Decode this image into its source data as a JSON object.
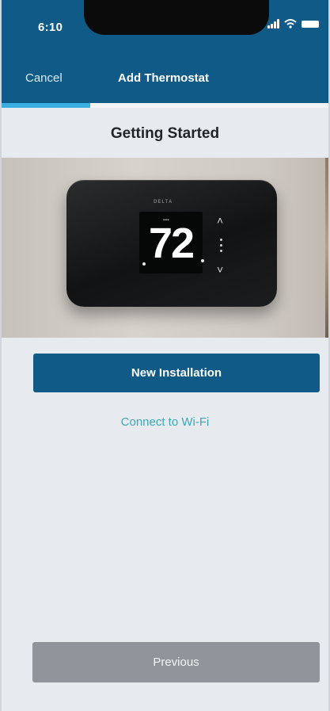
{
  "status_bar": {
    "time": "6:10",
    "signal_icon": "cellular-signal-icon",
    "wifi_icon": "wifi-icon",
    "battery_icon": "battery-icon"
  },
  "nav": {
    "cancel_label": "Cancel",
    "title": "Add Thermostat"
  },
  "progress": {
    "fraction": 0.27
  },
  "page": {
    "section_title": "Getting Started"
  },
  "thermostat_image": {
    "temperature": "72"
  },
  "actions": {
    "new_installation_label": "New Installation",
    "connect_wifi_label": "Connect to Wi-Fi",
    "previous_label": "Previous"
  },
  "colors": {
    "header_background": "#0f5a86",
    "progress_accent": "#39aee0",
    "link_color": "#3ea7b8",
    "disabled_button": "#8f959b"
  }
}
